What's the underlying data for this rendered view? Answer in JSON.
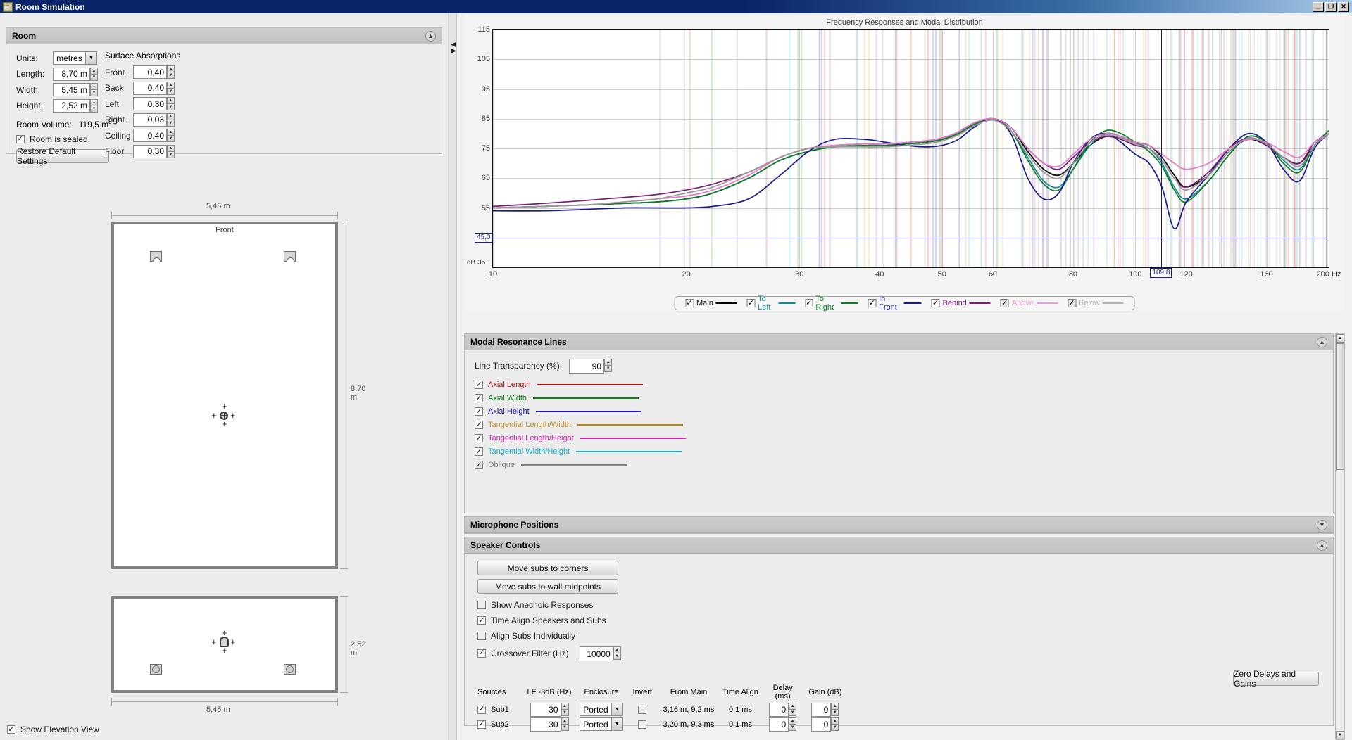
{
  "window": {
    "title": "Room Simulation",
    "icon": "java-cup-icon",
    "buttons": {
      "minimize": "_",
      "restore": "❐",
      "close": "✕"
    }
  },
  "room_panel": {
    "title": "Room",
    "collapse_icon": "chevron-up-icon",
    "units_label": "Units:",
    "units_value": "metres",
    "fields": [
      {
        "label": "Length:",
        "value": "8,70 m"
      },
      {
        "label": "Width:",
        "value": "5,45 m"
      },
      {
        "label": "Height:",
        "value": "2,52 m"
      }
    ],
    "volume_label": "Room Volume:",
    "volume_value": "119,5 m",
    "volume_exponent": "3",
    "sealed_label": "Room is sealed",
    "sealed_checked": "✓",
    "restore_button": "Restore Default Settings",
    "absorptions_title": "Surface Absorptions",
    "absorptions": [
      {
        "label": "Front",
        "value": "0,40"
      },
      {
        "label": "Back",
        "value": "0,40"
      },
      {
        "label": "Left",
        "value": "0,30"
      },
      {
        "label": "Right",
        "value": "0,03"
      },
      {
        "label": "Ceiling",
        "value": "0,40"
      },
      {
        "label": "Floor",
        "value": "0,30"
      }
    ]
  },
  "plan_view": {
    "top_dim": "5,45 m",
    "right_dim": "8,70 m",
    "front_label": "Front"
  },
  "elevation_view": {
    "bottom_dim": "5,45 m",
    "right_dim": "2,52 m"
  },
  "show_elevation": {
    "label": "Show Elevation View",
    "checked": "✓"
  },
  "chart_data": {
    "type": "line",
    "title": "Frequency Responses and Modal Distribution",
    "xlabel": "Hz",
    "ylabel": "dB",
    "db_axis_label": "dB 35",
    "xscale": "log",
    "xlim": [
      10,
      200
    ],
    "ylim": [
      35,
      115
    ],
    "yticks": [
      115,
      105,
      95,
      85,
      75,
      65,
      55
    ],
    "xticks": [
      10,
      20,
      30,
      40,
      50,
      60,
      80,
      100,
      120,
      160,
      200
    ],
    "xtick_labels": [
      "10",
      "20",
      "30",
      "40",
      "50",
      "60",
      "80",
      "100",
      "120",
      "160",
      "200 Hz"
    ],
    "cursor_x": "109,8",
    "cursor_y": "45,0",
    "grid": true,
    "legend_position": "bottom",
    "series": [
      {
        "name": "Main",
        "color": "#000000",
        "enabled": true,
        "x": [
          10,
          12,
          14,
          16,
          18,
          20,
          22,
          25,
          28,
          31,
          34,
          38,
          41,
          44,
          47,
          50,
          53,
          56,
          60,
          64,
          68,
          72,
          76,
          80,
          85,
          90,
          95,
          100,
          105,
          110,
          115,
          120,
          130,
          140,
          150,
          160,
          170,
          180,
          190,
          200
        ],
        "y": [
          55,
          55.5,
          56,
          56.5,
          57,
          58,
          60,
          65,
          71,
          74,
          75.5,
          76,
          76,
          76.5,
          77,
          78,
          80,
          83,
          85,
          82,
          74,
          68,
          66,
          70,
          76,
          79,
          78.5,
          77,
          76,
          72,
          66,
          62,
          66,
          74,
          78,
          76,
          72,
          70,
          76,
          80
        ]
      },
      {
        "name": "To Left",
        "color": "#108a8a",
        "enabled": true,
        "x": [
          10,
          12,
          14,
          16,
          18,
          20,
          22,
          25,
          28,
          31,
          34,
          38,
          41,
          44,
          47,
          50,
          53,
          56,
          60,
          64,
          68,
          72,
          76,
          80,
          85,
          90,
          95,
          100,
          105,
          110,
          115,
          120,
          130,
          140,
          150,
          160,
          170,
          180,
          190,
          200
        ],
        "y": [
          55,
          55.5,
          56,
          56.5,
          57,
          58,
          60,
          65,
          71,
          74,
          75.5,
          76,
          76,
          76.5,
          77,
          78,
          80,
          83,
          85,
          81,
          72,
          64,
          62,
          68,
          76,
          80,
          79,
          77,
          75,
          70,
          62,
          58,
          64,
          73,
          79,
          77,
          71,
          68,
          76,
          81
        ]
      },
      {
        "name": "To Right",
        "color": "#0f7d28",
        "enabled": true,
        "x": [
          10,
          12,
          14,
          16,
          18,
          20,
          22,
          25,
          28,
          31,
          34,
          38,
          41,
          44,
          47,
          50,
          53,
          56,
          60,
          64,
          68,
          72,
          76,
          80,
          85,
          90,
          95,
          100,
          105,
          110,
          115,
          120,
          130,
          140,
          150,
          160,
          170,
          180,
          190,
          200
        ],
        "y": [
          55,
          55.5,
          56,
          56.5,
          57,
          58,
          60,
          65,
          71,
          74,
          75.5,
          76,
          76,
          76.5,
          77,
          78,
          80,
          83,
          85,
          81,
          71,
          63,
          61,
          68,
          77,
          81,
          80,
          77,
          74,
          69,
          61,
          57,
          64,
          73,
          79,
          77,
          70,
          67,
          76,
          81
        ]
      },
      {
        "name": "In Front",
        "color": "#1a1a8c",
        "enabled": true,
        "x": [
          10,
          12,
          14,
          16,
          18,
          20,
          22,
          25,
          28,
          31,
          34,
          38,
          41,
          44,
          47,
          50,
          53,
          56,
          60,
          64,
          68,
          72,
          76,
          80,
          85,
          90,
          95,
          100,
          105,
          110,
          115,
          120,
          130,
          140,
          150,
          160,
          170,
          180,
          190,
          200
        ],
        "y": [
          54,
          54,
          54.5,
          55,
          55,
          55,
          55.5,
          58,
          66,
          74,
          78,
          78,
          77,
          76,
          75.5,
          76,
          78,
          82,
          85,
          80,
          65,
          58,
          60,
          70,
          78,
          80,
          77,
          73,
          70,
          62,
          48,
          57,
          66,
          75,
          80,
          77,
          68,
          64,
          75,
          80
        ]
      },
      {
        "name": "Behind",
        "color": "#7a1c7a",
        "enabled": true,
        "x": [
          10,
          12,
          14,
          16,
          18,
          20,
          22,
          25,
          28,
          31,
          34,
          38,
          41,
          44,
          47,
          50,
          53,
          56,
          60,
          64,
          68,
          72,
          76,
          80,
          85,
          90,
          95,
          100,
          105,
          110,
          115,
          120,
          130,
          140,
          150,
          160,
          170,
          180,
          190,
          200
        ],
        "y": [
          55.5,
          56.5,
          57.5,
          58.5,
          59.5,
          61,
          63,
          67,
          72,
          75,
          76,
          76.5,
          76.5,
          77,
          77.5,
          78.5,
          80.5,
          83.5,
          85,
          82,
          75,
          70,
          68,
          72,
          77,
          79,
          78,
          76,
          75,
          71,
          65,
          62,
          67,
          75,
          78.5,
          76,
          72,
          70,
          77,
          80
        ]
      },
      {
        "name": "Above",
        "color": "#e07ac8",
        "enabled": true,
        "x": [
          10,
          12,
          14,
          16,
          18,
          20,
          22,
          25,
          28,
          31,
          34,
          38,
          41,
          44,
          47,
          50,
          53,
          56,
          60,
          64,
          68,
          72,
          76,
          80,
          85,
          90,
          95,
          100,
          105,
          110,
          115,
          120,
          130,
          140,
          150,
          160,
          170,
          180,
          190,
          200
        ],
        "y": [
          55,
          55.5,
          56,
          57,
          58,
          59,
          61,
          66,
          72,
          75,
          76,
          76.5,
          76.5,
          77,
          77.5,
          78.5,
          80.5,
          83.5,
          85,
          82,
          75,
          70,
          69,
          73,
          78,
          80,
          79,
          77,
          76,
          73,
          70,
          68,
          70,
          75,
          78,
          77,
          74,
          72,
          77,
          80
        ]
      },
      {
        "name": "Below",
        "color": "#9a9a9a",
        "enabled": true,
        "x": [
          10,
          12,
          14,
          16,
          18,
          20,
          22,
          25,
          28,
          31,
          34,
          38,
          41,
          44,
          47,
          50,
          53,
          56,
          60,
          64,
          68,
          72,
          76,
          80,
          85,
          90,
          95,
          100,
          105,
          110,
          115,
          120,
          130,
          140,
          150,
          160,
          170,
          180,
          190,
          200
        ],
        "y": [
          55,
          55.5,
          56,
          57,
          58,
          60,
          62,
          67,
          72,
          75,
          75.5,
          75.5,
          75.5,
          76,
          76.5,
          77.5,
          79.5,
          82.5,
          84.5,
          81,
          73,
          67,
          65,
          70,
          77,
          79.5,
          78.5,
          76.5,
          75,
          71,
          65,
          61,
          66,
          74,
          78.5,
          76.5,
          72,
          69,
          76,
          80
        ]
      }
    ],
    "legend": [
      {
        "label": "Main",
        "color": "#000000",
        "checked": "✓",
        "text_color": "#111111"
      },
      {
        "label": "To Left",
        "color": "#108a8a",
        "checked": "✓",
        "text_color": "#108a8a"
      },
      {
        "label": "To Right",
        "color": "#0f7d28",
        "checked": "✓",
        "text_color": "#0f7d28"
      },
      {
        "label": "In Front",
        "color": "#1a1a8c",
        "checked": "✓",
        "text_color": "#1a1a8c"
      },
      {
        "label": "Behind",
        "color": "#7a1c7a",
        "checked": "✓",
        "text_color": "#7a1c7a"
      },
      {
        "label": "Above",
        "color": "#e79ed6",
        "checked": "✓",
        "text_color": "#e79ed6"
      },
      {
        "label": "Below",
        "color": "#b4b4b4",
        "checked": "✓",
        "text_color": "#b4b4b4"
      }
    ]
  },
  "modal_panel": {
    "title": "Modal Resonance Lines",
    "collapse_icon": "chevron-up-icon",
    "transparency_label": "Line Transparency (%):",
    "transparency_value": "90",
    "lines": [
      {
        "label": "Axial Length",
        "color": "#aa1111",
        "checked": "✓"
      },
      {
        "label": "Axial Width",
        "color": "#0f7d1a",
        "checked": "✓"
      },
      {
        "label": "Axial Height",
        "color": "#1a1aa8",
        "checked": "✓"
      },
      {
        "label": "Tangential Length/Width",
        "color": "#b8860b",
        "checked": "✓"
      },
      {
        "label": "Tangential Length/Height",
        "color": "#cc22aa",
        "checked": "✓"
      },
      {
        "label": "Tangential Width/Height",
        "color": "#10b0c8",
        "checked": "✓"
      },
      {
        "label": "Oblique",
        "color": "#808080",
        "checked": "✓"
      }
    ]
  },
  "microphone_panel": {
    "title": "Microphone Positions",
    "collapse_icon": "chevron-down-icon"
  },
  "speaker_panel": {
    "title": "Speaker Controls",
    "collapse_icon": "chevron-up-icon",
    "move_corners_button": "Move subs to corners",
    "move_midpoints_button": "Move subs to wall midpoints",
    "checkboxes": [
      {
        "label": "Show Anechoic Responses",
        "checked": ""
      },
      {
        "label": "Time Align Speakers and Subs",
        "checked": "✓"
      },
      {
        "label": "Align Subs Individually",
        "checked": ""
      }
    ],
    "crossover_label": "Crossover Filter (Hz)",
    "crossover_checked": "✓",
    "crossover_value": "10000",
    "zero_button": "Zero Delays and Gains",
    "table_headers": [
      "Sources",
      "LF -3dB (Hz)",
      "Enclosure",
      "Invert",
      "From Main",
      "Time Align",
      "Delay (ms)",
      "Gain (dB)"
    ],
    "rows": [
      {
        "name": "Sub1",
        "checked": "✓",
        "lf": "30",
        "enclosure": "Ported",
        "invert": "",
        "from_main": "3,16 m, 9,2 ms",
        "time_align": "0,1 ms",
        "delay": "0",
        "gain": "0"
      },
      {
        "name": "Sub2",
        "checked": "✓",
        "lf": "30",
        "enclosure": "Ported",
        "invert": "",
        "from_main": "3,20 m, 9,3 ms",
        "time_align": "0,1 ms",
        "delay": "0",
        "gain": "0"
      }
    ]
  }
}
